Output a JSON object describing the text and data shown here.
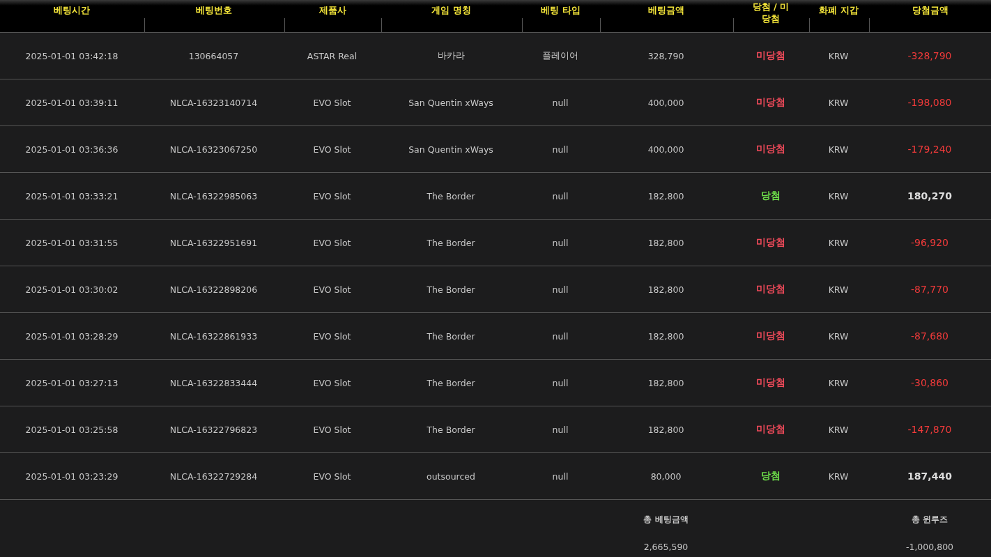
{
  "table": {
    "columns": [
      "베팅시간",
      "베팅번호",
      "제품사",
      "게임 명칭",
      "베팅 타입",
      "베팅금액",
      "당첨 / 미당첨",
      "화폐 지갑",
      "당첨금액"
    ],
    "rows": [
      {
        "time": "2025-01-01 03:42:18",
        "bet_id": "130664057",
        "provider": "ASTAR Real",
        "game": "바카라",
        "bet_type": "플레이어",
        "amount": "328,790",
        "result": "미당첨",
        "won": false,
        "currency": "KRW",
        "payout": "-328,790"
      },
      {
        "time": "2025-01-01 03:39:11",
        "bet_id": "NLCA-16323140714",
        "provider": "EVO Slot",
        "game": "San Quentin xWays",
        "bet_type": "null",
        "amount": "400,000",
        "result": "미당첨",
        "won": false,
        "currency": "KRW",
        "payout": "-198,080"
      },
      {
        "time": "2025-01-01 03:36:36",
        "bet_id": "NLCA-16323067250",
        "provider": "EVO Slot",
        "game": "San Quentin xWays",
        "bet_type": "null",
        "amount": "400,000",
        "result": "미당첨",
        "won": false,
        "currency": "KRW",
        "payout": "-179,240"
      },
      {
        "time": "2025-01-01 03:33:21",
        "bet_id": "NLCA-16322985063",
        "provider": "EVO Slot",
        "game": "The Border",
        "bet_type": "null",
        "amount": "182,800",
        "result": "당첨",
        "won": true,
        "currency": "KRW",
        "payout": "180,270"
      },
      {
        "time": "2025-01-01 03:31:55",
        "bet_id": "NLCA-16322951691",
        "provider": "EVO Slot",
        "game": "The Border",
        "bet_type": "null",
        "amount": "182,800",
        "result": "미당첨",
        "won": false,
        "currency": "KRW",
        "payout": "-96,920"
      },
      {
        "time": "2025-01-01 03:30:02",
        "bet_id": "NLCA-16322898206",
        "provider": "EVO Slot",
        "game": "The Border",
        "bet_type": "null",
        "amount": "182,800",
        "result": "미당첨",
        "won": false,
        "currency": "KRW",
        "payout": "-87,770"
      },
      {
        "time": "2025-01-01 03:28:29",
        "bet_id": "NLCA-16322861933",
        "provider": "EVO Slot",
        "game": "The Border",
        "bet_type": "null",
        "amount": "182,800",
        "result": "미당첨",
        "won": false,
        "currency": "KRW",
        "payout": "-87,680"
      },
      {
        "time": "2025-01-01 03:27:13",
        "bet_id": "NLCA-16322833444",
        "provider": "EVO Slot",
        "game": "The Border",
        "bet_type": "null",
        "amount": "182,800",
        "result": "미당첨",
        "won": false,
        "currency": "KRW",
        "payout": "-30,860"
      },
      {
        "time": "2025-01-01 03:25:58",
        "bet_id": "NLCA-16322796823",
        "provider": "EVO Slot",
        "game": "The Border",
        "bet_type": "null",
        "amount": "182,800",
        "result": "미당첨",
        "won": false,
        "currency": "KRW",
        "payout": "-147,870"
      },
      {
        "time": "2025-01-01 03:23:29",
        "bet_id": "NLCA-16322729284",
        "provider": "EVO Slot",
        "game": "outsourced",
        "bet_type": "null",
        "amount": "80,000",
        "result": "당첨",
        "won": true,
        "currency": "KRW",
        "payout": "187,440"
      }
    ]
  },
  "totals": {
    "bet_label": "총 베팅금액",
    "bet_value": "2,665,590",
    "winloss_label": "총 윈루즈",
    "winloss_value": "-1,000,800"
  }
}
